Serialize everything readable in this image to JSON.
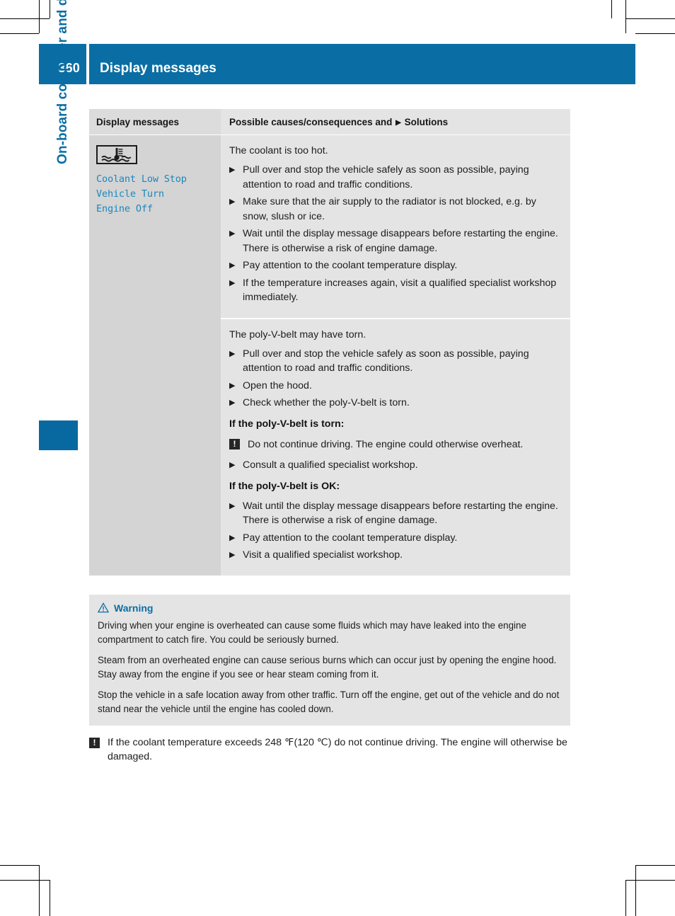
{
  "page": {
    "number": "360",
    "header_title": "Display messages",
    "chapter_label": "On-board computer and displays"
  },
  "table": {
    "header": {
      "left": "Display messages",
      "right_prefix": "Possible causes/consequences and",
      "right_arrow": "▶",
      "right_suffix": "Solutions"
    },
    "message": {
      "icon_name": "coolant-temperature-warning-icon",
      "lines": [
        "Coolant Low Stop",
        "Vehicle Turn",
        "Engine Off"
      ]
    },
    "blocks": [
      {
        "lead": "The coolant is too hot.",
        "items": [
          {
            "type": "step",
            "text": "Pull over and stop the vehicle safely as soon as possible, paying attention to road and traffic conditions."
          },
          {
            "type": "step",
            "text": "Make sure that the air supply to the radiator is not blocked, e.g. by snow, slush or ice."
          },
          {
            "type": "step",
            "text": "Wait until the display message disappears before restarting the engine. There is otherwise a risk of engine damage."
          },
          {
            "type": "step",
            "text": "Pay attention to the coolant temperature display."
          },
          {
            "type": "step",
            "text": "If the temperature increases again, visit a qualified specialist workshop immediately."
          }
        ]
      },
      {
        "lead": "The poly-V-belt may have torn.",
        "items": [
          {
            "type": "step",
            "text": "Pull over and stop the vehicle safely as soon as possible, paying attention to road and traffic conditions."
          },
          {
            "type": "step",
            "text": "Open the hood."
          },
          {
            "type": "step",
            "text": "Check whether the poly-V-belt is torn."
          },
          {
            "type": "heading",
            "text": "If the poly-V-belt is torn:"
          },
          {
            "type": "notice",
            "text": "Do not continue driving. The engine could otherwise overheat."
          },
          {
            "type": "step",
            "text": "Consult a qualified specialist workshop."
          },
          {
            "type": "heading",
            "text": "If the poly-V-belt is OK:"
          },
          {
            "type": "step",
            "text": "Wait until the display message disappears before restarting the engine. There is otherwise a risk of engine damage."
          },
          {
            "type": "step",
            "text": "Pay attention to the coolant temperature display."
          },
          {
            "type": "step",
            "text": "Visit a qualified specialist workshop."
          }
        ]
      }
    ]
  },
  "warning": {
    "title": "Warning",
    "icon_name": "warning-triangle-icon",
    "paragraphs": [
      "Driving when your engine is overheated can cause some fluids which may have leaked into the engine compartment to catch fire. You could be seriously burned.",
      "Steam from an overheated engine can cause serious burns which can occur just by opening the engine hood. Stay away from the engine if you see or hear steam coming from it.",
      "Stop the vehicle in a safe location away from other traffic. Turn off the engine, get out of the vehicle and do not stand near the vehicle until the engine has cooled down."
    ]
  },
  "tail_notice": {
    "icon_name": "notice-exclamation-icon",
    "glyph": "!",
    "text": "If the coolant temperature exceeds 248 ℉(120 ℃) do not continue driving. The engine will otherwise be damaged."
  },
  "colors": {
    "brand_blue": "#0a6ea4",
    "tab_blue": "#0769a0",
    "message_blue": "#1c87bd",
    "panel_gray": "#e4e4e4",
    "left_col_gray": "#d4d4d4"
  }
}
